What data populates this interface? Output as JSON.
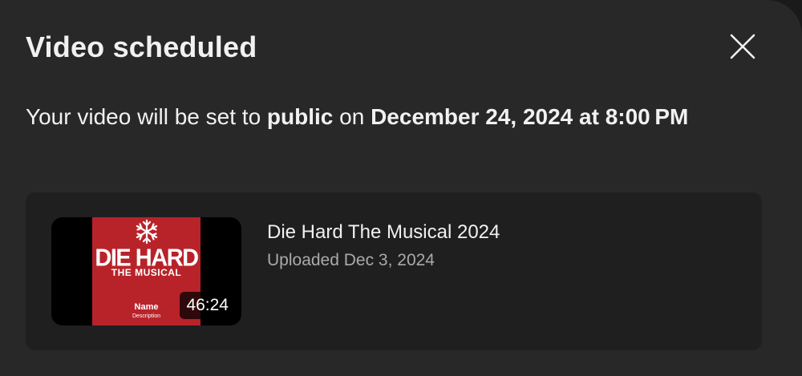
{
  "dialog": {
    "title": "Video scheduled",
    "close_icon": "close-icon",
    "message": {
      "prefix": "Your video will be set to ",
      "visibility": "public",
      "middle": " on ",
      "datetime": "December 24, 2024 at 8:00 PM"
    }
  },
  "video": {
    "title": "Die Hard The Musical 2024",
    "uploaded": "Uploaded Dec 3, 2024",
    "duration": "46:24",
    "thumbnail": {
      "icon": "snowflake-icon",
      "poster_title": "DIE HARD",
      "poster_subtitle": "THE MUSICAL",
      "poster_name": "Name",
      "poster_description": "Description",
      "poster_color": "#b8232a"
    }
  },
  "colors": {
    "dialog_bg": "#282828",
    "card_bg": "#1f1f1f",
    "text_primary": "#f1f1f1",
    "text_secondary": "#aaaaaa"
  }
}
